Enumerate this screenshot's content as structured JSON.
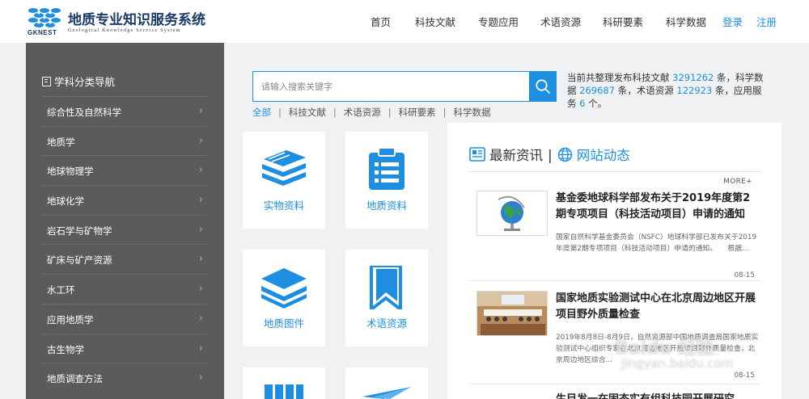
{
  "header": {
    "logo_abbr": "GKNEST",
    "title": "地质专业知识服务系统",
    "subtitle": "Geological Knowledge Service System",
    "nav": [
      "首页",
      "科技文献",
      "专题应用",
      "术语资源",
      "科研要素",
      "科学数据"
    ],
    "login": "登录",
    "register": "注册"
  },
  "sidebar": {
    "title": "学科分类导航",
    "items": [
      "综合性及自然科学",
      "地质学",
      "地球物理学",
      "地球化学",
      "岩石学与矿物学",
      "矿床与矿产资源",
      "水工环",
      "应用地质学",
      "古生物学",
      "地质调查方法"
    ]
  },
  "search": {
    "placeholder": "请输入搜索关键字",
    "filters": [
      "全部",
      "科技文献",
      "术语资源",
      "科研要素",
      "科学数据"
    ],
    "active_filter": "全部"
  },
  "stats": {
    "p1": "当前共整理发布科技文献 ",
    "literature": "3291262",
    "p2": " 条，科学数据 ",
    "data": "269687",
    "p3": " 条，术语资源 ",
    "terms": "122923",
    "p4": " 条，应用服务 ",
    "services": "6",
    "p5": " 个。"
  },
  "tiles": [
    "实物资料",
    "地质资料",
    "地质图件",
    "术语资源"
  ],
  "news": {
    "tab1": "最新资讯",
    "divider": "|",
    "tab2": "网站动态",
    "more": "MORE+",
    "articles": [
      {
        "title": "基金委地球科学部发布关于2019年度第2期专项项目（科技活动项目）申请的通知",
        "summary": "国家自然科学基金委员会（NSFC）地球科学部已发布关于2019年度第2期专项项目（科技活动项目）申请的通知。　　根据...",
        "date": "08-15"
      },
      {
        "title": "国家地质实验测试中心在北京周边地区开展项目野外质量检查",
        "summary": "2019年8月8日-8月9日，自然资源部中国地质调查局国家地质实验测试中心组织专家在北京周边地区开展项目野外质量检查，北京周边地区综合...",
        "date": "08-15"
      },
      {
        "title": "生目发一在固态实有组科技园开展研究"
      }
    ]
  },
  "watermark": {
    "main": "Baidu 经验",
    "sub": "jingyan.baidu.com"
  },
  "colors": {
    "accent": "#1e8fe0",
    "sidebar": "#5b5b5b",
    "background": "#f0f1f3"
  }
}
